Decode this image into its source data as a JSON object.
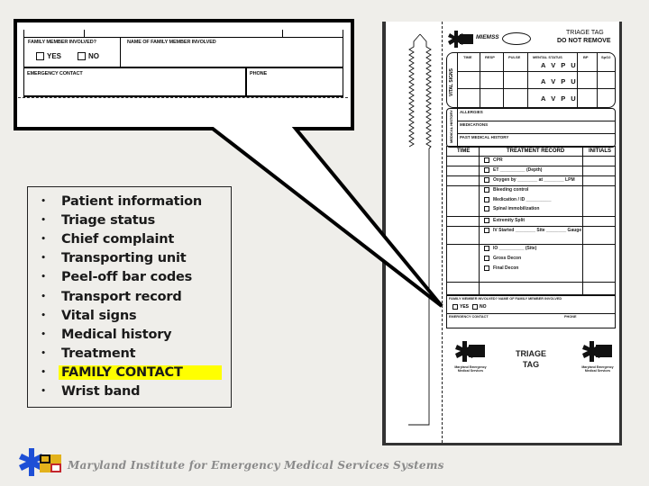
{
  "callout": {
    "family_member_involved_label": "FAMILY MEMBER INVOLVED?",
    "name_of_family_member_label": "NAME OF FAMILY MEMBER INVOLVED",
    "yes_label": "YES",
    "no_label": "NO",
    "emergency_contact_label": "EMERGENCY CONTACT",
    "phone_label": "PHONE"
  },
  "feature_list": {
    "items": [
      {
        "label": "Patient information",
        "highlighted": false
      },
      {
        "label": "Triage status",
        "highlighted": false
      },
      {
        "label": "Chief complaint",
        "highlighted": false
      },
      {
        "label": "Transporting unit",
        "highlighted": false
      },
      {
        "label": "Peel-off bar codes",
        "highlighted": false
      },
      {
        "label": "Transport record",
        "highlighted": false
      },
      {
        "label": "Vital signs",
        "highlighted": false
      },
      {
        "label": "Medical history",
        "highlighted": false
      },
      {
        "label": "Treatment",
        "highlighted": false
      },
      {
        "label": "FAMILY CONTACT",
        "highlighted": true
      },
      {
        "label": "Wrist band",
        "highlighted": false
      }
    ],
    "bullet": "•",
    "highlight_color": "#ffff00"
  },
  "triage_tag": {
    "org_short": "MIEMSS",
    "title_line1": "TRIAGE TAG",
    "title_line2": "DO NOT REMOVE",
    "vitals": {
      "side_label": "VITAL SIGNS",
      "headers": [
        "TIME",
        "RESP",
        "PULSE",
        "MENTAL STATUS",
        "BP",
        "SpO2"
      ],
      "avpu": "A V P U"
    },
    "medical_history": {
      "side_label": "MEDICAL HISTORY",
      "rows": [
        "ALLERGIES",
        "MEDICATIONS",
        "PAST MEDICAL HISTORY"
      ]
    },
    "treatment": {
      "headers": [
        "TIME",
        "TREATMENT RECORD",
        "INITIALS"
      ],
      "items": [
        "CPR",
        "ET __________ (Depth)",
        "Oxygen by ________ at ________ LPM",
        "Bleeding control",
        "Medication / ID __________",
        "Spinal immobilization",
        "Extremity Split",
        "IV Started ________ Site ________ Gauge",
        "IO __________ (Site)",
        "Gross Decon",
        "Final Decon"
      ]
    },
    "family": {
      "family_member_involved_label": "FAMILY MEMBER INVOLVED?",
      "name_of_family_member_label": "NAME OF FAMILY MEMBER INVOLVED",
      "yes_label": "YES",
      "no_label": "NO",
      "emergency_contact_label": "EMERGENCY CONTACT",
      "phone_label": "PHONE"
    },
    "bottom_title_line1": "TRIAGE",
    "bottom_title_line2": "TAG",
    "logo_caption_line1": "Maryland Emergency",
    "logo_caption_line2": "Medical Services"
  },
  "footer": {
    "org_name": "Maryland Institute for Emergency Medical Services Systems"
  },
  "colors": {
    "background": "#efeeea",
    "highlight": "#ffff00",
    "logo_blue": "#1e4fd6",
    "flag_gold": "#e3b21c",
    "flag_red": "#c4262e"
  }
}
